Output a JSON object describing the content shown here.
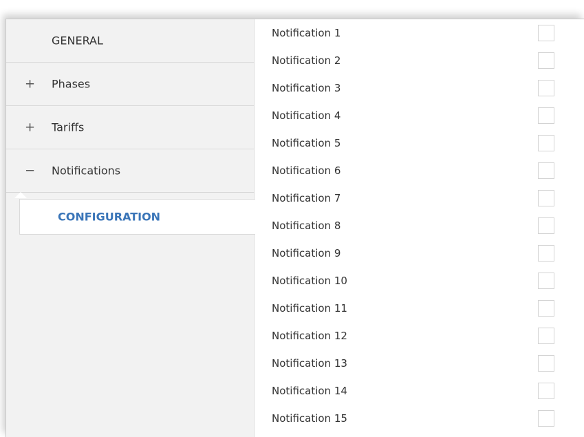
{
  "sidebar": {
    "items": [
      {
        "sign": "",
        "label": "GENERAL"
      },
      {
        "sign": "+",
        "label": "Phases"
      },
      {
        "sign": "+",
        "label": "Tariffs"
      },
      {
        "sign": "−",
        "label": "Notifications"
      }
    ],
    "subitem": {
      "label": "CONFIGURATION"
    }
  },
  "notifications": [
    {
      "label": "Notification 1",
      "checked": false
    },
    {
      "label": "Notification 2",
      "checked": false
    },
    {
      "label": "Notification 3",
      "checked": false
    },
    {
      "label": "Notification 4",
      "checked": false
    },
    {
      "label": "Notification 5",
      "checked": false
    },
    {
      "label": "Notification 6",
      "checked": false
    },
    {
      "label": "Notification 7",
      "checked": false
    },
    {
      "label": "Notification 8",
      "checked": false
    },
    {
      "label": "Notification 9",
      "checked": false
    },
    {
      "label": "Notification 10",
      "checked": false
    },
    {
      "label": "Notification 11",
      "checked": false
    },
    {
      "label": "Notification 12",
      "checked": false
    },
    {
      "label": "Notification 13",
      "checked": false
    },
    {
      "label": "Notification 14",
      "checked": false
    },
    {
      "label": "Notification 15",
      "checked": false
    }
  ],
  "colors": {
    "accent": "#3a75b8",
    "sidebar_bg": "#f2f2f2"
  }
}
